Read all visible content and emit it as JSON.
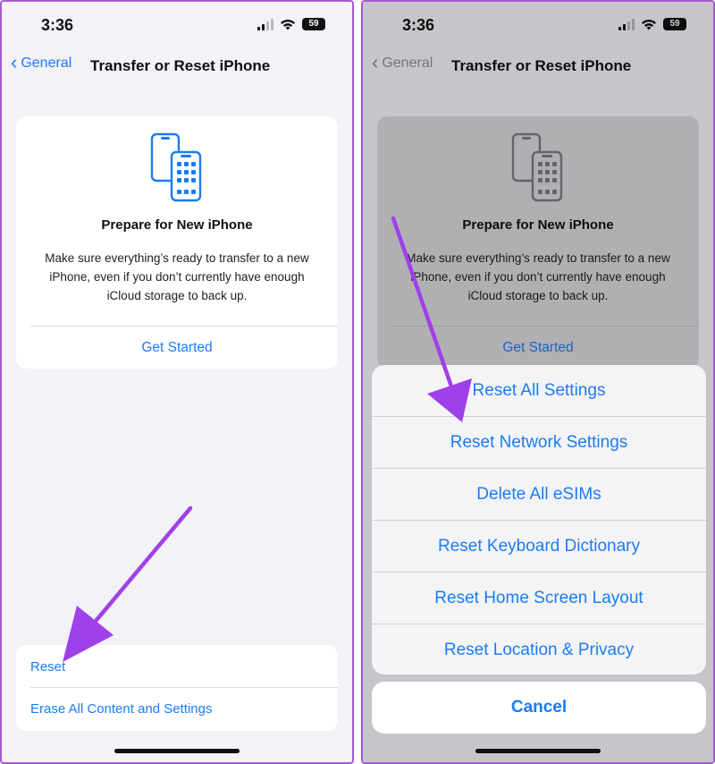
{
  "status": {
    "time": "3:36",
    "battery": "59"
  },
  "nav": {
    "back_label": "General",
    "title": "Transfer or Reset iPhone"
  },
  "prepare_card": {
    "title": "Prepare for New iPhone",
    "description": "Make sure everything’s ready to transfer to a new iPhone, even if you don’t currently have enough iCloud storage to back up.",
    "link": "Get Started"
  },
  "bottom_list": {
    "items": [
      "Reset",
      "Erase All Content and Settings"
    ]
  },
  "action_sheet": {
    "items": [
      "Reset All Settings",
      "Reset Network Settings",
      "Delete All eSIMs",
      "Reset Keyboard Dictionary",
      "Reset Home Screen Layout",
      "Reset Location & Privacy"
    ],
    "cancel": "Cancel"
  },
  "colors": {
    "accent": "#1a7cf5",
    "annotation_arrow": "#a040e8",
    "frame_border": "#a65bd0"
  },
  "icons": {
    "back": "chevron-left-icon",
    "signal": "cellular-signal-icon",
    "wifi": "wifi-icon",
    "battery": "battery-icon",
    "transfer": "phones-transfer-icon"
  }
}
